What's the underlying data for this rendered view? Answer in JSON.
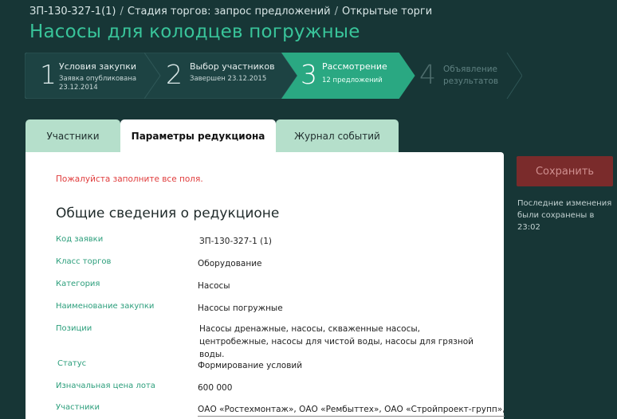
{
  "breadcrumb": {
    "code": "ЗП-130-327-1(1)",
    "separator": "/",
    "stage": "Стадия торгов: запрос предложений",
    "type": "Открытые торги"
  },
  "title": "Насосы для колодцев погружные",
  "stepper": {
    "steps": [
      {
        "number": "1",
        "label": "Условия закупки",
        "sub1": "Заявка опубликована",
        "sub2": "23.12.2014",
        "state": "done"
      },
      {
        "number": "2",
        "label": "Выбор участников",
        "sub1": "Завершен 23.12.2015",
        "sub2": "",
        "state": "done"
      },
      {
        "number": "3",
        "label": "Рассмотрение",
        "sub1": "12 предложений",
        "sub2": "",
        "state": "active"
      },
      {
        "number": "4",
        "label": "Объявление результатов",
        "sub1": "",
        "sub2": "",
        "state": "pending"
      }
    ]
  },
  "tabs": [
    {
      "label": "Участники",
      "active": false
    },
    {
      "label": "Параметры редукциона",
      "active": true
    },
    {
      "label": "Журнал событий",
      "active": false
    }
  ],
  "form": {
    "alert": "Пожалуйста заполните все поля.",
    "section_title": "Общие сведения о редукционе",
    "fields": [
      {
        "label": "Код заявки",
        "value": "ЗП-130-327-1 (1)"
      },
      {
        "label": "Класс торгов",
        "value": "Оборудование"
      },
      {
        "label": "Категория",
        "value": "Насосы"
      },
      {
        "label": "Наименование закупки",
        "value": "Насосы погружные"
      },
      {
        "label": "Позиции",
        "value": "Насосы дренажные, насосы, скваженные насосы, центробежные, насосы для чистой воды, насосы для грязной воды."
      },
      {
        "label": "Статус",
        "value": "Формирование условий"
      },
      {
        "label": "Изначальная цена лота",
        "value": "600 000"
      },
      {
        "label": "Участники",
        "value": "ОАО «Ростехмонтаж», ОАО «Рембыттех», ОАО «Стройпроект-групп»,"
      }
    ]
  },
  "sidebar": {
    "save_label": "Сохранить",
    "note": "Последние изменения были сохранены в 23:02"
  },
  "colors": {
    "background": "#173636",
    "accent": "#2aa882",
    "save_button": "#7a2b2b",
    "tab_inactive": "#b5dfcb",
    "error": "#e03c3c"
  }
}
